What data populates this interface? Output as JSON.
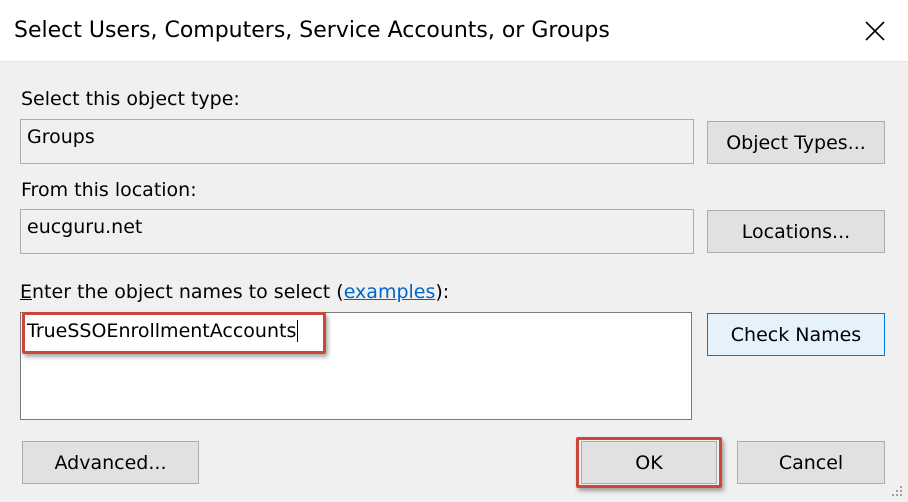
{
  "dialog": {
    "title": "Select Users, Computers, Service Accounts, or Groups"
  },
  "object_type": {
    "label": "Select this object type:",
    "value": "Groups",
    "button_label": "Object Types..."
  },
  "location": {
    "label": "From this location:",
    "value": "eucguru.net",
    "button_label": "Locations..."
  },
  "names": {
    "label_first_char": "E",
    "label_rest": "nter the object names to select (",
    "link_text": "examples",
    "label_suffix": "):",
    "value": "TrueSSOEnrollmentAccounts",
    "check_button_label": "Check Names"
  },
  "footer": {
    "advanced_label": "Advanced...",
    "ok_label": "OK",
    "cancel_label": "Cancel"
  },
  "colors": {
    "highlight": "#c9483a",
    "link": "#0066cc",
    "default_button_border": "#0078d7"
  },
  "icons": {
    "close": "close-icon",
    "resize": "resize-grip-icon"
  }
}
